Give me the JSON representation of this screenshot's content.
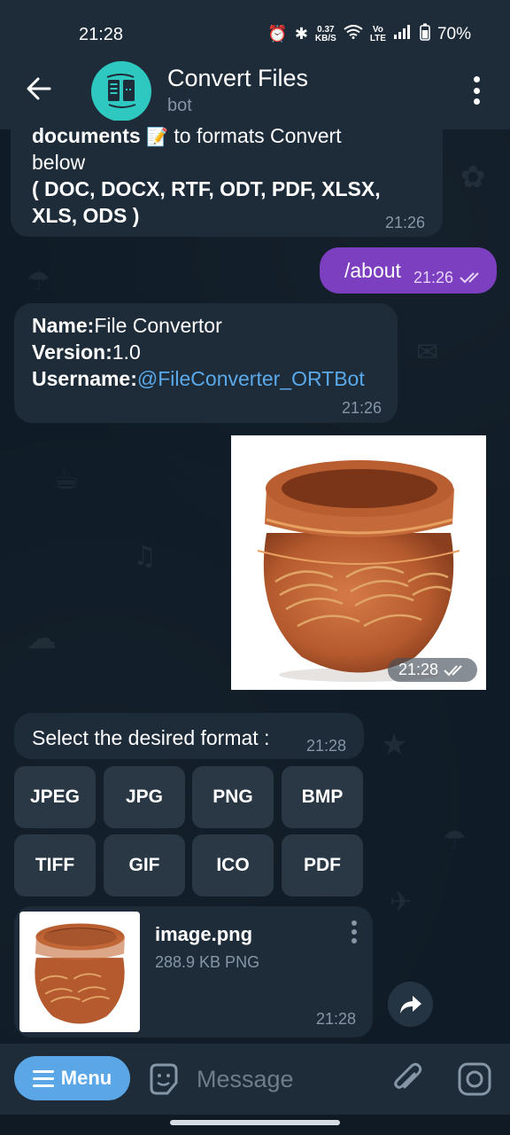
{
  "status_bar": {
    "time": "21:28",
    "net_speed_top": "0.37",
    "net_speed_unit": "KB/S",
    "battery": "70%"
  },
  "header": {
    "title": "Convert Files",
    "subtitle": "bot"
  },
  "messages": {
    "intro": {
      "line1_bold": "documents",
      "line1_rest": " to formats Convert",
      "line2": "below",
      "line3": "( DOC, DOCX, RTF, ODT, PDF, XLSX,",
      "line4": "XLS, ODS )",
      "time": "21:26"
    },
    "about": {
      "text": "/about",
      "time": "21:26"
    },
    "info": {
      "name_key": "Name:",
      "name_val": "File Convertor",
      "version_key": "Version:",
      "version_val": "1.0",
      "username_key": "Username:",
      "username_val": "@FileConverter_ORTBot",
      "time": "21:26"
    },
    "photo": {
      "time": "21:28"
    },
    "select": {
      "text": "Select the desired format :",
      "time": "21:28"
    },
    "file": {
      "name": "image.png",
      "info": "288.9 KB PNG",
      "time": "21:28"
    }
  },
  "keyboard": {
    "row1": [
      "JPEG",
      "JPG",
      "PNG",
      "BMP"
    ],
    "row2": [
      "TIFF",
      "GIF",
      "ICO",
      "PDF"
    ]
  },
  "input_bar": {
    "menu_label": "Menu",
    "placeholder": "Message"
  },
  "colors": {
    "outgoing_bubble": "#7b3fbf",
    "incoming_bubble": "#1e2c3a",
    "link": "#5aa9ea",
    "menu_button": "#5aa6e6"
  }
}
